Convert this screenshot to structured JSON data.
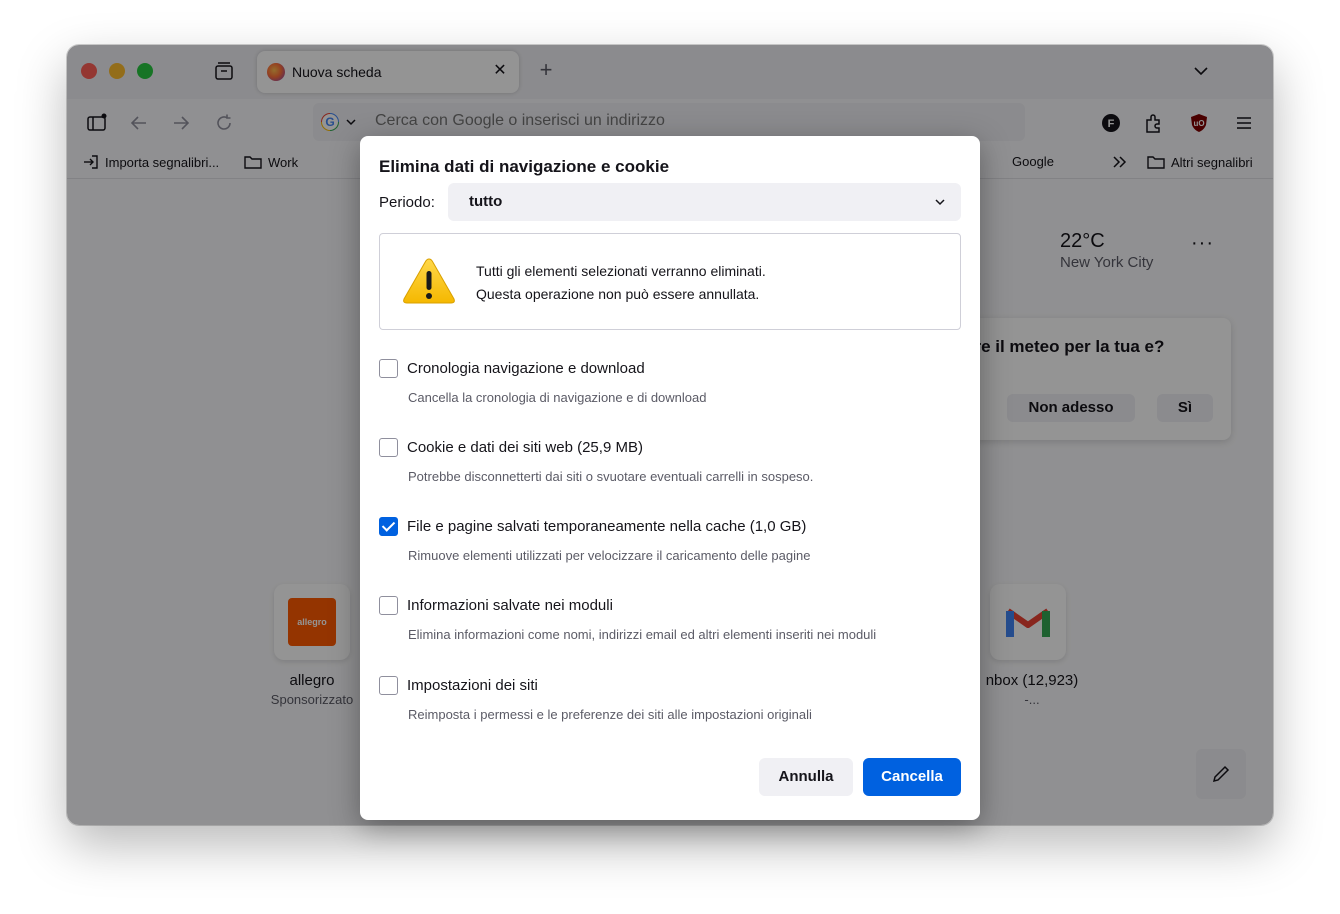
{
  "tab": {
    "title": "Nuova scheda"
  },
  "urlbar": {
    "placeholder": "Cerca con Google o inserisci un indirizzo"
  },
  "bookmarks": {
    "import_label": "Importa segnalibri...",
    "work_label": "Work",
    "google_label": "Google",
    "other_label": "Altri segnalibri"
  },
  "weather": {
    "temp": "22°C",
    "city": "New York City",
    "prompt": "ere il meteo per la tua e?",
    "not_now": "Non adesso",
    "yes": "Sì"
  },
  "shortcuts": [
    {
      "name": "allegro",
      "sub": "Sponsorizzato",
      "logo": "allegro"
    },
    {
      "name": "nbox (12,923)",
      "sub": "-..."
    }
  ],
  "dialog": {
    "title": "Elimina dati di navigazione e cookie",
    "period_label": "Periodo:",
    "period_value": "tutto",
    "warning_line1": "Tutti gli elementi selezionati verranno eliminati.",
    "warning_line2": "Questa operazione non può essere annullata.",
    "items": [
      {
        "label": "Cronologia navigazione e download",
        "desc": "Cancella la cronologia di navigazione e di download",
        "checked": false
      },
      {
        "label": "Cookie e dati dei siti web (25,9 MB)",
        "desc": "Potrebbe disconnetterti dai siti o svuotare eventuali carrelli in sospeso.",
        "checked": false
      },
      {
        "label": "File e pagine salvati temporaneamente nella cache (1,0 GB)",
        "desc": "Rimuove elementi utilizzati per velocizzare il caricamento delle pagine",
        "checked": true
      },
      {
        "label": "Informazioni salvate nei moduli",
        "desc": "Elimina informazioni come nomi, indirizzi email ed altri elementi inseriti nei moduli",
        "checked": false
      },
      {
        "label": "Impostazioni dei siti",
        "desc": "Reimposta i permessi e le preferenze dei siti alle impostazioni originali",
        "checked": false
      }
    ],
    "cancel_label": "Annulla",
    "confirm_label": "Cancella"
  },
  "colors": {
    "accent": "#0061e0",
    "overlay": "rgba(0,0,0,0.42)"
  }
}
